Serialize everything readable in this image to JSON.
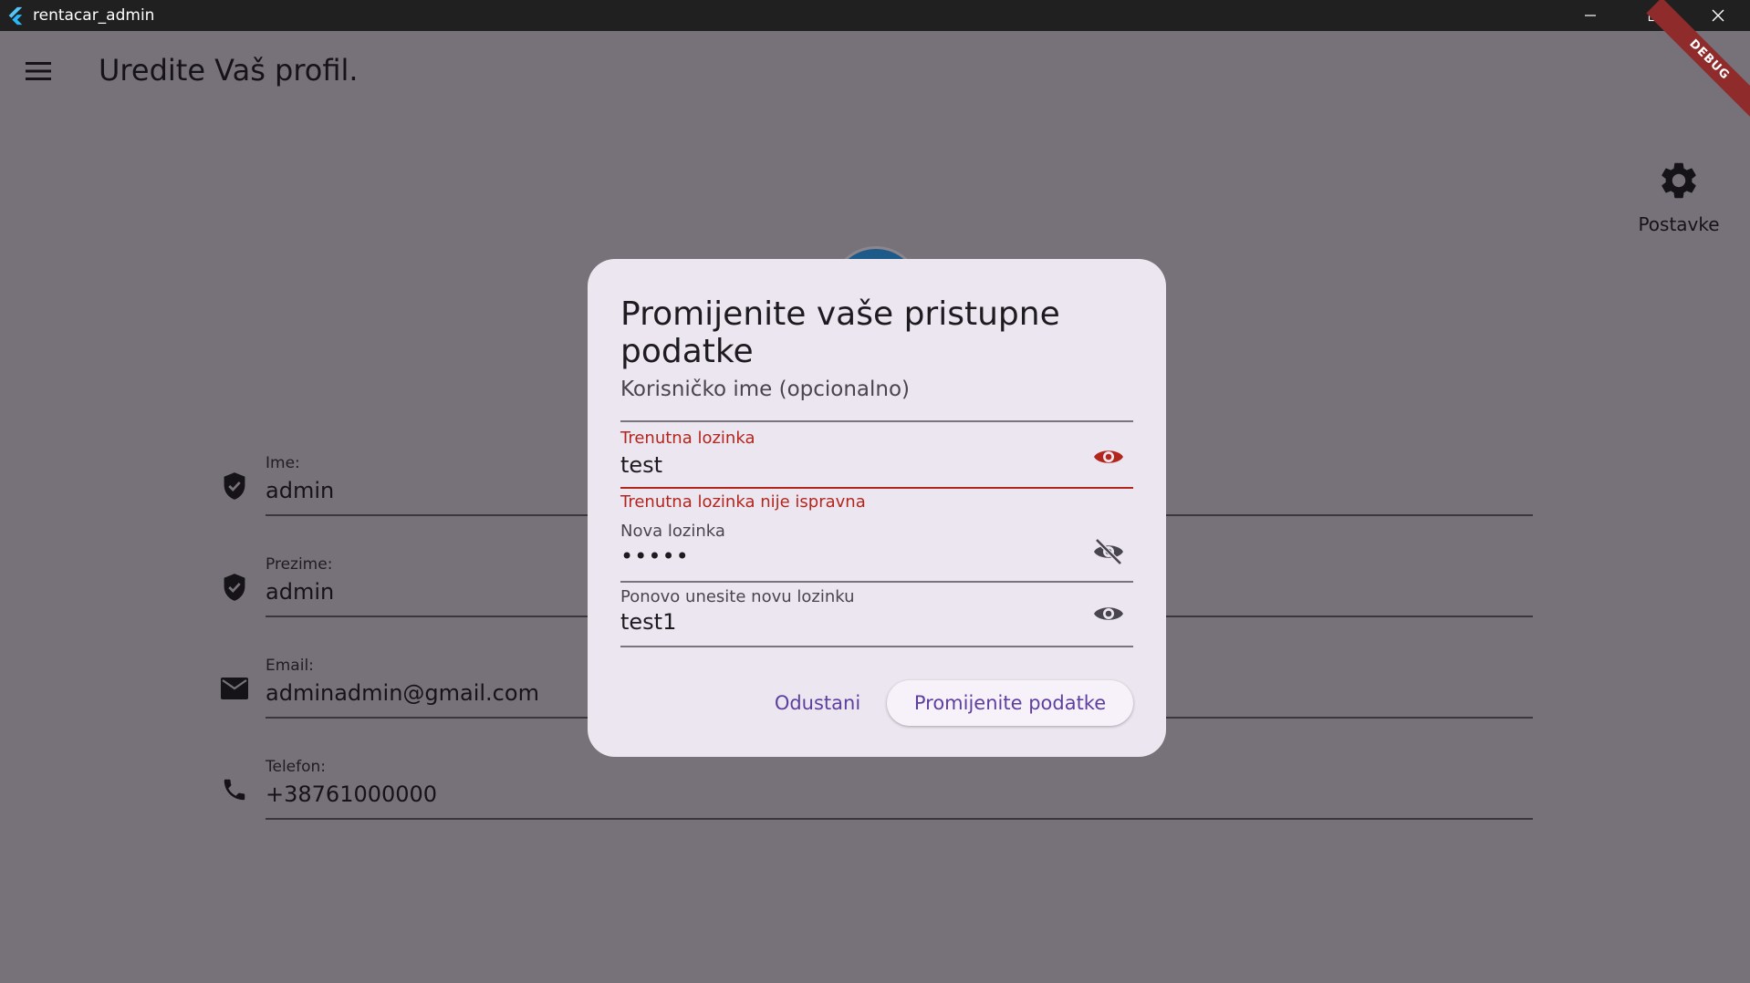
{
  "window": {
    "title": "rentacar_admin"
  },
  "page": {
    "title": "Uredite Vaš profil.",
    "debug_label": "DEBUG",
    "settings_label": "Postavke",
    "fields": [
      {
        "label": "Ime:",
        "value": "admin",
        "icon": "verified-shield-icon"
      },
      {
        "label": "Prezime:",
        "value": "admin",
        "icon": "verified-shield-icon"
      },
      {
        "label": "Email:",
        "value": "adminadmin@gmail.com",
        "icon": "mail-icon"
      },
      {
        "label": "Telefon:",
        "value": "+38761000000",
        "icon": "phone-icon"
      }
    ]
  },
  "dialog": {
    "title": "Promijenite vaše pristupne podatke",
    "username": {
      "placeholder": "Korisničko ime (opcionalno)"
    },
    "current_password": {
      "label": "Trenutna lozinka",
      "value": "test",
      "error": "Trenutna lozinka nije ispravna"
    },
    "new_password": {
      "label": "Nova lozinka",
      "value": "•••••"
    },
    "repeat_password": {
      "label": "Ponovo unesite novu lozinku",
      "value": "test1"
    },
    "cancel_label": "Odustani",
    "submit_label": "Promijenite podatke"
  },
  "colors": {
    "error": "#b3261e",
    "primary": "#5d3f9e",
    "dialog_bg": "#ece6f0",
    "scrim": "#787378"
  }
}
